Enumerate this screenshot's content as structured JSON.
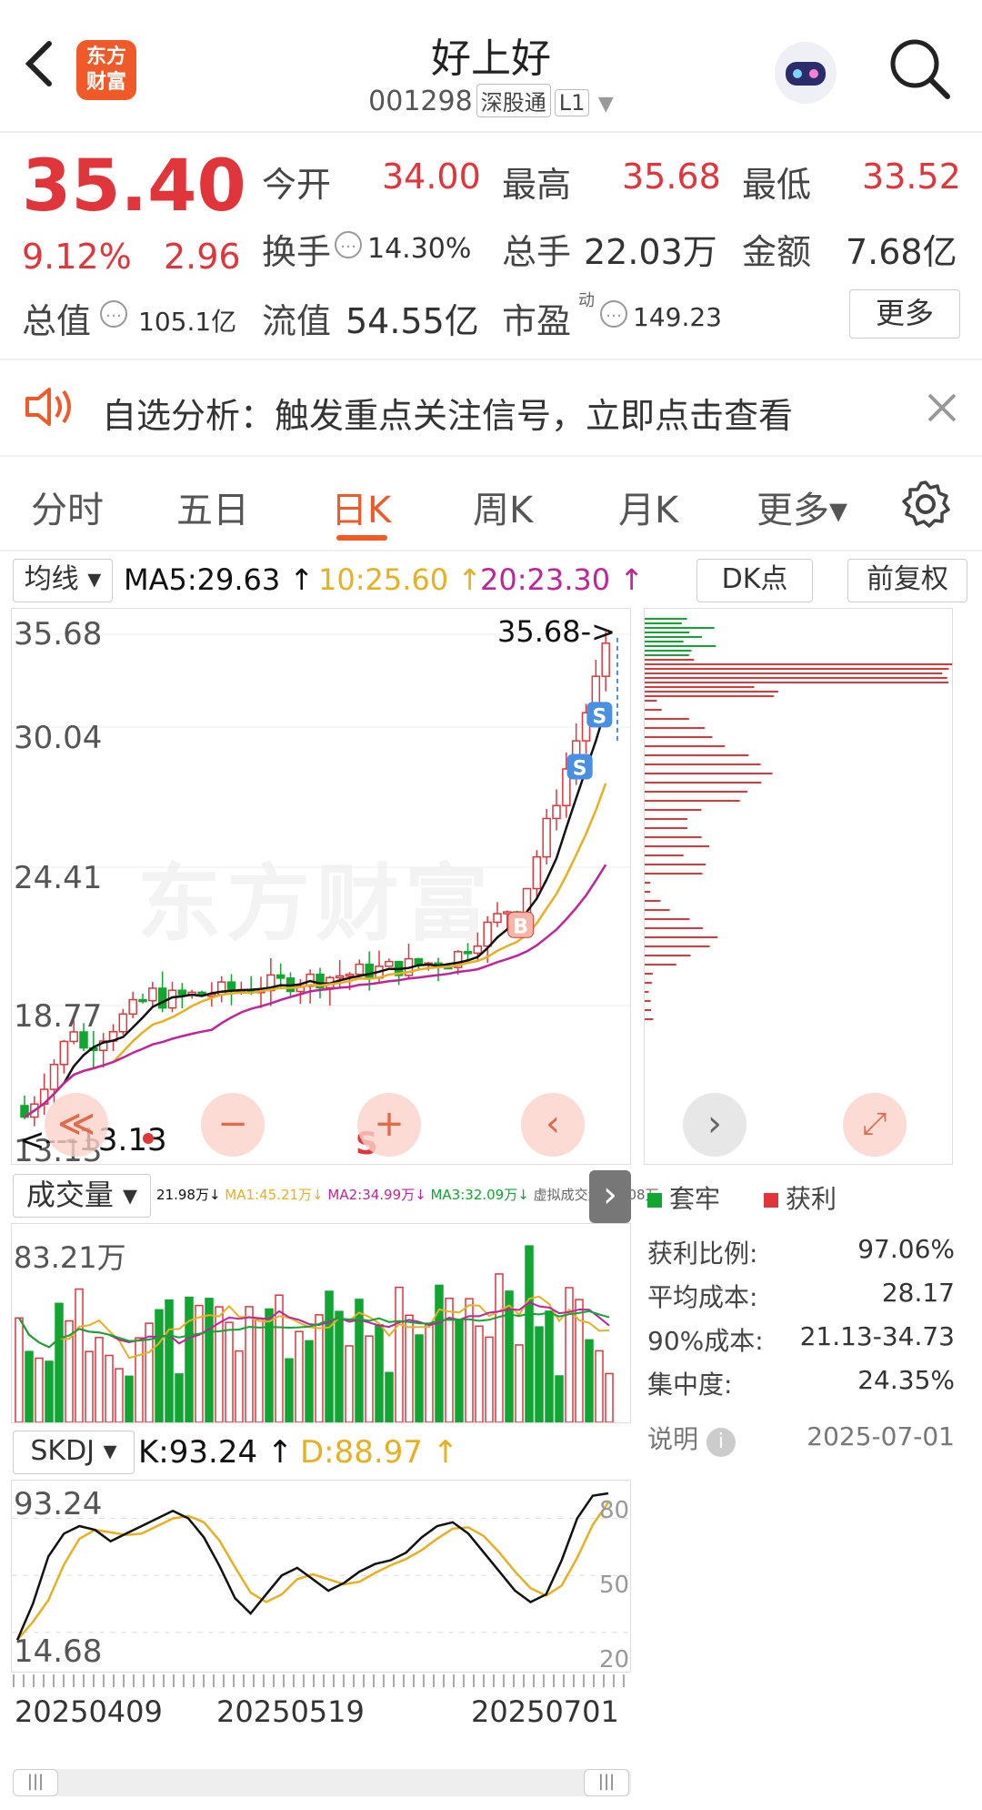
{
  "header": {
    "back_label": "‹",
    "logo_text_1": "东方",
    "logo_text_2": "财富",
    "title": "好上好",
    "code": "001298",
    "market_tag": "深股通",
    "level_tag": "L1"
  },
  "quote": {
    "price": "35.40",
    "change_pct": "9.12%",
    "change_amt": "2.96",
    "open_label": "今开",
    "open_val": "34.00",
    "high_label": "最高",
    "high_val": "35.68",
    "low_label": "最低",
    "low_val": "33.52",
    "turnover_label": "换手",
    "turnover_val": "14.30%",
    "volume_label": "总手",
    "volume_val": "22.03万",
    "amount_label": "金额",
    "amount_val": "7.68亿",
    "mktcap_label": "总值",
    "mktcap_val": "105.1亿",
    "float_label": "流值",
    "float_val": "54.55亿",
    "pe_label": "市盈",
    "pe_sup": "动",
    "pe_val": "149.23",
    "more_btn": "更多"
  },
  "notice": {
    "text": "自选分析：触发重点关注信号，立即点击查看"
  },
  "tabs": [
    {
      "label": "分时",
      "active": false
    },
    {
      "label": "五日",
      "active": false
    },
    {
      "label": "日K",
      "active": true
    },
    {
      "label": "周K",
      "active": false
    },
    {
      "label": "月K",
      "active": false
    },
    {
      "label": "更多▾",
      "active": false
    }
  ],
  "ma_bar": {
    "selector": "均线 ▾",
    "ma5": "MA5:29.63 ↑",
    "ma10": "10:25.60 ↑",
    "ma20": "20:23.30 ↑",
    "dk_btn": "DK点",
    "fq_btn": "前复权"
  },
  "kline": {
    "yticks": [
      "35.68",
      "30.04",
      "24.41",
      "18.77",
      "13.13"
    ],
    "max_label": "35.68->",
    "min_label": "<---13.13",
    "watermark": "东方财富",
    "buy_marker": "B",
    "sell_marker": "S",
    "s_marker_text": "S"
  },
  "volume_bar": {
    "selector": "成交量 ▾",
    "vol": "21.98万↓",
    "ma1": "MA1:45.21万↓",
    "ma2": "MA2:34.99万↓",
    "ma3": "MA3:32.09万↓",
    "virtual": "虚拟成交量:43.08万",
    "max_label": "83.21万"
  },
  "skdj_bar": {
    "selector": "SKDJ ▾",
    "k": "K:93.24 ↑",
    "d": "D:88.97 ↑",
    "top_label": "93.24",
    "bottom_label": "14.68",
    "lvl80": "80",
    "lvl50": "50",
    "lvl20": "20"
  },
  "dates": [
    "20250409",
    "20250519",
    "20250701"
  ],
  "chip": {
    "legend_trapped": "套牢",
    "legend_profit": "获利",
    "profit_ratio_label": "获利比例:",
    "profit_ratio_val": "97.06%",
    "avg_cost_label": "平均成本:",
    "avg_cost_val": "28.17",
    "cost90_label": "90%成本:",
    "cost90_val": "21.13-34.73",
    "concentration_label": "集中度:",
    "concentration_val": "24.35%",
    "explain_label": "说明",
    "date": "2025-07-01"
  },
  "colors": {
    "up": "#e0353b",
    "down": "#11a531",
    "ma5": "#111111",
    "ma10": "#e8b020",
    "ma20": "#c0249a",
    "accent": "#f05a28"
  }
}
